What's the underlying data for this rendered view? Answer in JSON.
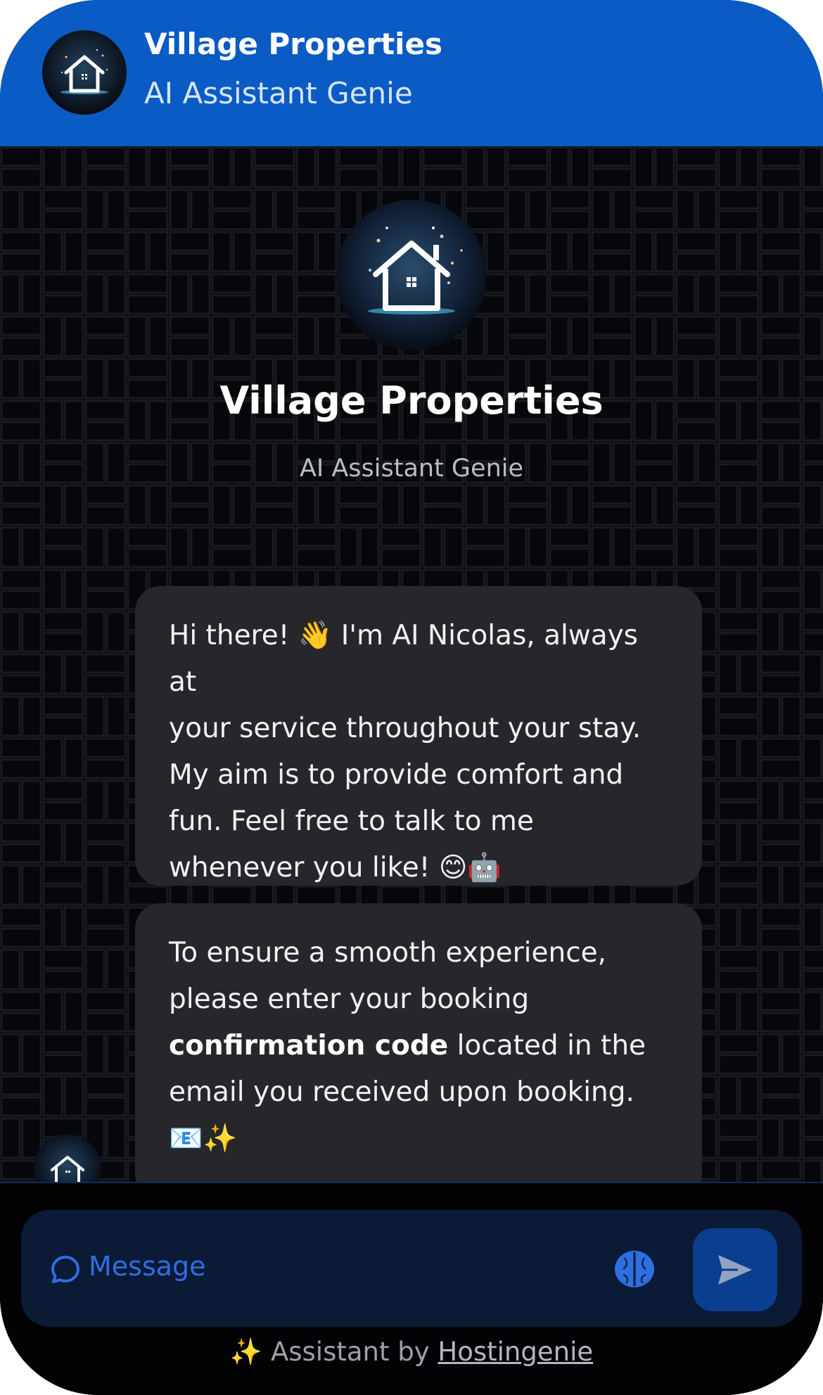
{
  "header": {
    "title": "Village Properties",
    "subtitle": "AI Assistant Genie",
    "avatar_icon": "house-logo-icon"
  },
  "hero": {
    "title": "Village Properties",
    "subtitle": "AI Assistant Genie",
    "avatar_icon": "house-logo-icon"
  },
  "messages": [
    {
      "sender": "assistant",
      "line1": "Hi there! 👋 I'm AI Nicolas, always at",
      "line2": "your service throughout your stay.",
      "line3": "My aim is to provide comfort and",
      "line4": "fun. Feel free to talk to me",
      "line5": "whenever you like! 😊🤖"
    },
    {
      "sender": "assistant",
      "line1": "To ensure a smooth experience,",
      "line2": "please enter your booking",
      "line3_bold": "confirmation code",
      "line3_rest": " located in the",
      "line4": "email you received upon booking.",
      "line5": "📧✨"
    }
  ],
  "composer": {
    "placeholder": "Message",
    "message_icon": "chat-bubble-icon",
    "brain_icon": "brain-icon",
    "send_icon": "send-arrow-icon"
  },
  "footer": {
    "sparkle": "✨",
    "prefix": "Assistant by ",
    "link": "Hostingenie"
  },
  "colors": {
    "header_bg": "#0a5bc4",
    "chat_bg": "#06070a",
    "bubble_bg": "#26262b",
    "accent": "#2d6fe0",
    "send_bg": "#0a3f8f"
  }
}
